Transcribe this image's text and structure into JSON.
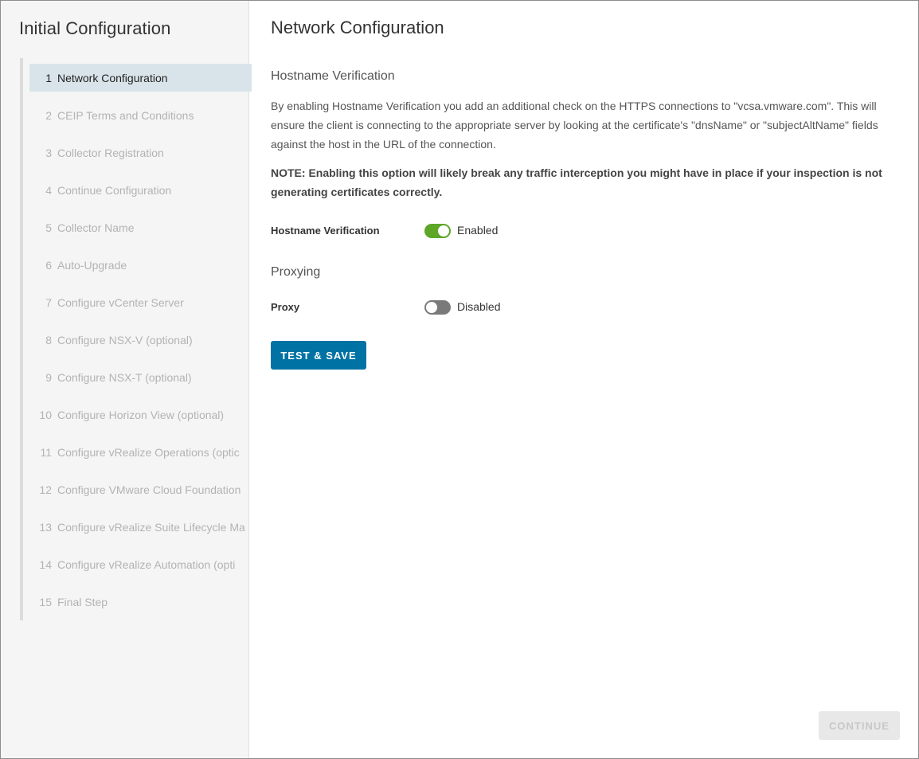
{
  "sidebar": {
    "title": "Initial Configuration",
    "steps": [
      {
        "num": "1",
        "label": "Network Configuration",
        "active": true
      },
      {
        "num": "2",
        "label": "CEIP Terms and Conditions",
        "active": false
      },
      {
        "num": "3",
        "label": "Collector Registration",
        "active": false
      },
      {
        "num": "4",
        "label": "Continue Configuration",
        "active": false
      },
      {
        "num": "5",
        "label": "Collector Name",
        "active": false
      },
      {
        "num": "6",
        "label": "Auto-Upgrade",
        "active": false
      },
      {
        "num": "7",
        "label": "Configure vCenter Server",
        "active": false
      },
      {
        "num": "8",
        "label": "Configure NSX-V (optional)",
        "active": false
      },
      {
        "num": "9",
        "label": "Configure NSX-T (optional)",
        "active": false
      },
      {
        "num": "10",
        "label": "Configure Horizon View (optional)",
        "active": false
      },
      {
        "num": "11",
        "label": "Configure vRealize Operations (optic",
        "active": false
      },
      {
        "num": "12",
        "label": "Configure VMware Cloud Foundation",
        "active": false
      },
      {
        "num": "13",
        "label": "Configure vRealize Suite Lifecycle Ma",
        "active": false
      },
      {
        "num": "14",
        "label": "Configure vRealize Automation (opti",
        "active": false
      },
      {
        "num": "15",
        "label": "Final Step",
        "active": false
      }
    ]
  },
  "main": {
    "title": "Network Configuration",
    "hostname_section": {
      "title": "Hostname Verification",
      "description": "By enabling Hostname Verification you add an additional check on the HTTPS connections to \"vcsa.vmware.com\". This will ensure the client is connecting to the appropriate server by looking at the certificate's \"dnsName\" or \"subjectAltName\" fields against the host in the URL of the connection.",
      "note": "NOTE: Enabling this option will likely break any traffic interception you might have in place if your inspection is not generating certificates correctly.",
      "field_label": "Hostname Verification",
      "toggle_state": "Enabled",
      "toggle_on": true
    },
    "proxy_section": {
      "title": "Proxying",
      "field_label": "Proxy",
      "toggle_state": "Disabled",
      "toggle_on": false
    },
    "test_save_label": "TEST & SAVE",
    "continue_label": "CONTINUE"
  },
  "colors": {
    "accent": "#0072a3",
    "toggle_on": "#5ea628",
    "toggle_off": "#7a7a7a",
    "active_step_bg": "#d9e4ea"
  }
}
